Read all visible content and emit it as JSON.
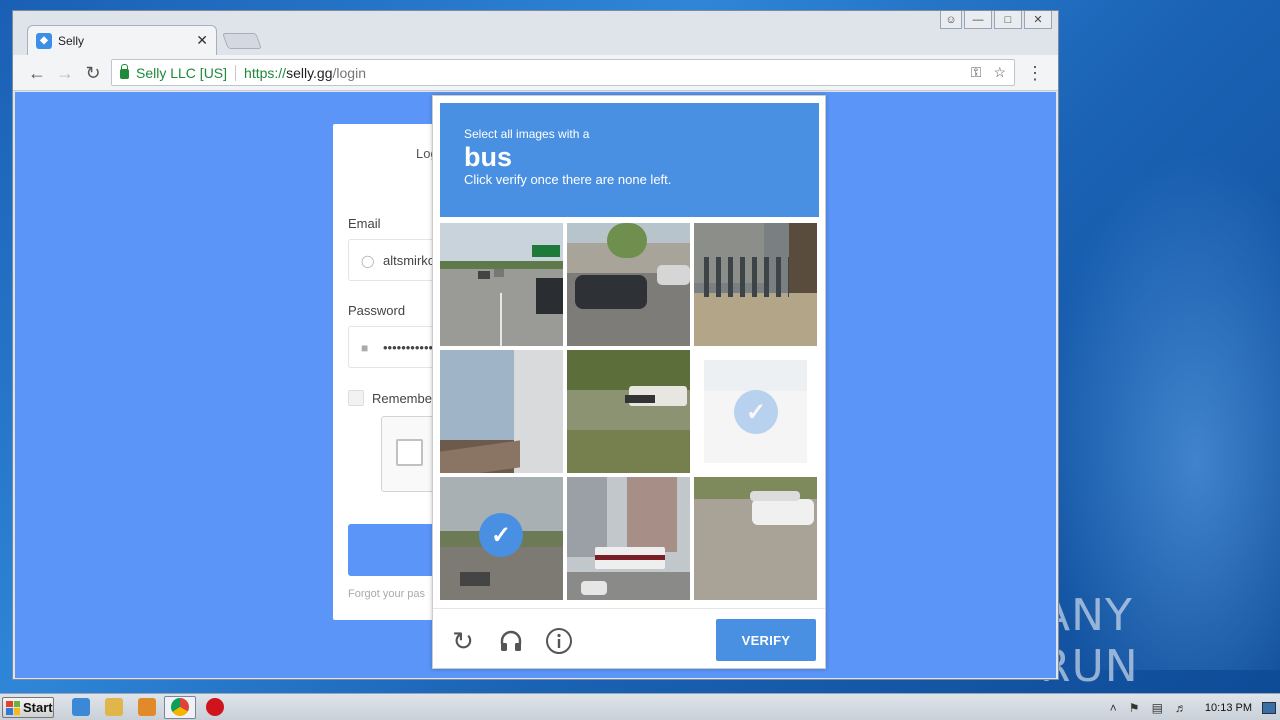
{
  "desktop": {
    "watermark": "ANY RUN"
  },
  "browser": {
    "tab_title": "Selly",
    "tab_close": "✕",
    "site_identity": "Selly LLC [US]",
    "url_scheme": "https://",
    "url_host": "selly.gg",
    "url_path": "/login",
    "icons": [
      "back-icon",
      "forward-icon",
      "reload-icon",
      "key-icon",
      "star-icon",
      "menu-icon"
    ]
  },
  "login": {
    "title": "Log",
    "email_label": "Email",
    "email_value": "altsmirko",
    "password_label": "Password",
    "password_value": "•••••••••••",
    "remember_label": "Remember",
    "forgot_text": "Forgot your pas"
  },
  "captcha": {
    "instruction": "Select all images with a",
    "target": "bus",
    "subtext": "Click verify once there are none left.",
    "verify_label": "VERIFY",
    "tiles": [
      {
        "scene": "highway",
        "selected": false
      },
      {
        "scene": "street-car",
        "selected": false
      },
      {
        "scene": "bike-rack",
        "selected": false
      },
      {
        "scene": "house",
        "selected": false
      },
      {
        "scene": "school-bus",
        "selected": false
      },
      {
        "scene": "van",
        "selected": true
      },
      {
        "scene": "traffic",
        "selected": true
      },
      {
        "scene": "city-bus",
        "selected": false
      },
      {
        "scene": "parking-lot",
        "selected": false
      }
    ]
  },
  "taskbar": {
    "start_label": "Start",
    "clock": "10:13 PM"
  }
}
